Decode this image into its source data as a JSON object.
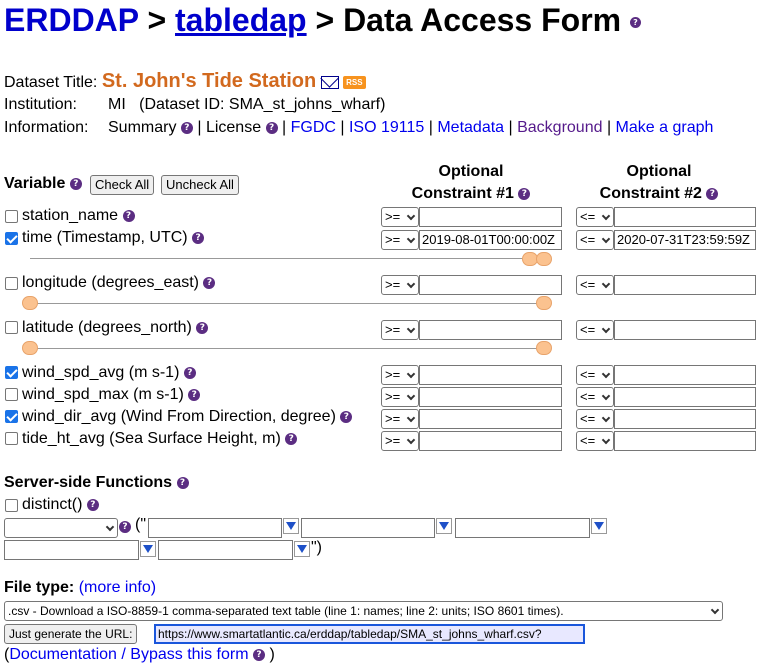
{
  "header": {
    "brand": "ERDDAP",
    "sep1": " > ",
    "tabledap": "tabledap",
    "sep2": " > Data Access Form"
  },
  "dataset": {
    "title_label": "Dataset Title:",
    "title": "St. John's Tide Station",
    "rss": "RSS",
    "institution_label": "Institution:",
    "institution": "MI",
    "dataset_id": "(Dataset ID: SMA_st_johns_wharf)",
    "information_label": "Information:",
    "summary": "Summary",
    "sep": " | ",
    "license": "License",
    "fgdc": "FGDC",
    "iso": "ISO 19115",
    "metadata": "Metadata",
    "background": "Background",
    "make_graph": "Make a graph"
  },
  "table": {
    "variable_header": "Variable",
    "check_all": "Check All",
    "uncheck_all": "Uncheck All",
    "constraint1": [
      "Optional",
      "Constraint #1"
    ],
    "constraint2": [
      "Optional",
      "Constraint #2"
    ],
    "op1": ">=",
    "op2": "<=",
    "variables": [
      {
        "label": "station_name",
        "checked": false,
        "c1": "",
        "c2": ""
      },
      {
        "label": "time (Timestamp, UTC)",
        "checked": true,
        "c1": "2019-08-01T00:00:00Z",
        "c2": "2020-07-31T23:59:59Z"
      },
      {
        "label": "longitude (degrees_east)",
        "checked": false,
        "c1": "",
        "c2": ""
      },
      {
        "label": "latitude (degrees_north)",
        "checked": false,
        "c1": "",
        "c2": ""
      },
      {
        "label": "wind_spd_avg (m s-1)",
        "checked": true,
        "c1": "",
        "c2": ""
      },
      {
        "label": "wind_spd_max (m s-1)",
        "checked": false,
        "c1": "",
        "c2": ""
      },
      {
        "label": "wind_dir_avg (Wind From Direction, degree)",
        "checked": true,
        "c1": "",
        "c2": ""
      },
      {
        "label": "tide_ht_avg (Sea Surface Height, m)",
        "checked": false,
        "c1": "",
        "c2": ""
      }
    ]
  },
  "functions": {
    "header": "Server-side Functions",
    "distinct": "distinct()",
    "open_paren": "(\"",
    "close_paren": "\")"
  },
  "filetype": {
    "label": "File type:",
    "more_info": "(more info)",
    "selected": ".csv - Download a ISO-8859-1 comma-separated text table (line 1: names; line 2: units; ISO 8601 times).",
    "generate_url_button": "Just generate the URL:",
    "url": "https://www.smartatlantic.ca/erddap/tabledap/SMA_st_johns_wharf.csv?",
    "doc_open": "(",
    "doc_link": "Documentation / Bypass this form",
    "doc_close": ")"
  },
  "colors": {
    "link": "#0000ee",
    "visited": "#551a8b",
    "title": "#d2691e",
    "help_icon": "#5b2d82",
    "slider_handle": "#fbc28f"
  },
  "icons": [
    "question-icon",
    "envelope-icon",
    "rss-icon",
    "dropdown-arrow-icon"
  ]
}
